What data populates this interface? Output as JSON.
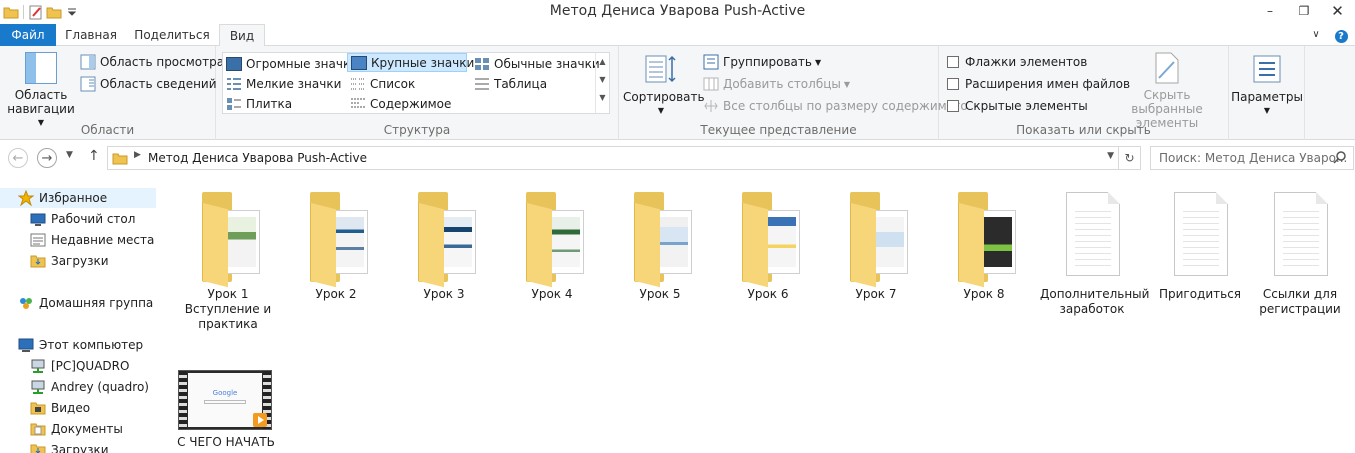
{
  "window": {
    "title": "Метод Дениса Уварова Push-Active",
    "minimize": "–",
    "maximize": "❐",
    "close": "✕"
  },
  "tabs": {
    "file": "Файл",
    "home": "Главная",
    "share": "Поделиться",
    "view": "Вид",
    "expand": "∨",
    "help": "?"
  },
  "ribbon": {
    "panes": {
      "label": "Области",
      "nav_pane": "Область навигации",
      "preview": "Область просмотра",
      "details": "Область сведений"
    },
    "layout": {
      "label": "Структура",
      "items": [
        "Огромные значки",
        "Крупные значки",
        "Обычные значки",
        "Мелкие значки",
        "Список",
        "Таблица",
        "Плитка",
        "Содержимое"
      ],
      "selected": "Крупные значки"
    },
    "current_view": {
      "label": "Текущее представление",
      "sort": "Сортировать",
      "group": "Группировать",
      "add_columns": "Добавить столбцы",
      "fit_columns": "Все столбцы по размеру содержимого"
    },
    "show_hide": {
      "label": "Показать или скрыть",
      "checkboxes": [
        "Флажки элементов",
        "Расширения имен файлов",
        "Скрытые элементы"
      ],
      "hide_selected": "Скрыть выбранные элементы"
    },
    "options": "Параметры"
  },
  "address": {
    "path": "Метод Дениса Уварова Push-Active",
    "search_placeholder": "Поиск: Метод Дениса Уваро..."
  },
  "nav_pane": {
    "favorites": "Избранное",
    "favorites_items": [
      "Рабочий стол",
      "Недавние места",
      "Загрузки"
    ],
    "homegroup": "Домашняя группа",
    "computer": "Этот компьютер",
    "computer_items": [
      "[PC]QUADRO",
      "Andrey (quadro)",
      "Видео",
      "Документы",
      "Загрузки"
    ]
  },
  "items": [
    {
      "name": "Урок 1 Вступление и практика",
      "kind": "folder"
    },
    {
      "name": "Урок 2",
      "kind": "folder"
    },
    {
      "name": "Урок 3",
      "kind": "folder"
    },
    {
      "name": "Урок 4",
      "kind": "folder"
    },
    {
      "name": "Урок 5",
      "kind": "folder"
    },
    {
      "name": "Урок 6",
      "kind": "folder"
    },
    {
      "name": "Урок 7",
      "kind": "folder"
    },
    {
      "name": "Урок 8",
      "kind": "folder"
    },
    {
      "name": "Дополнительный заработок",
      "kind": "file"
    },
    {
      "name": "Пригодиться",
      "kind": "file"
    },
    {
      "name": "Ссылки для регистрации",
      "kind": "file"
    },
    {
      "name": "С ЧЕГО НАЧАТЬ",
      "kind": "video"
    }
  ],
  "video_thumb": {
    "brand": "Google"
  },
  "colors": {
    "accent": "#1979ca",
    "selection": "#cde8ff",
    "folder": "#f7d67a"
  }
}
